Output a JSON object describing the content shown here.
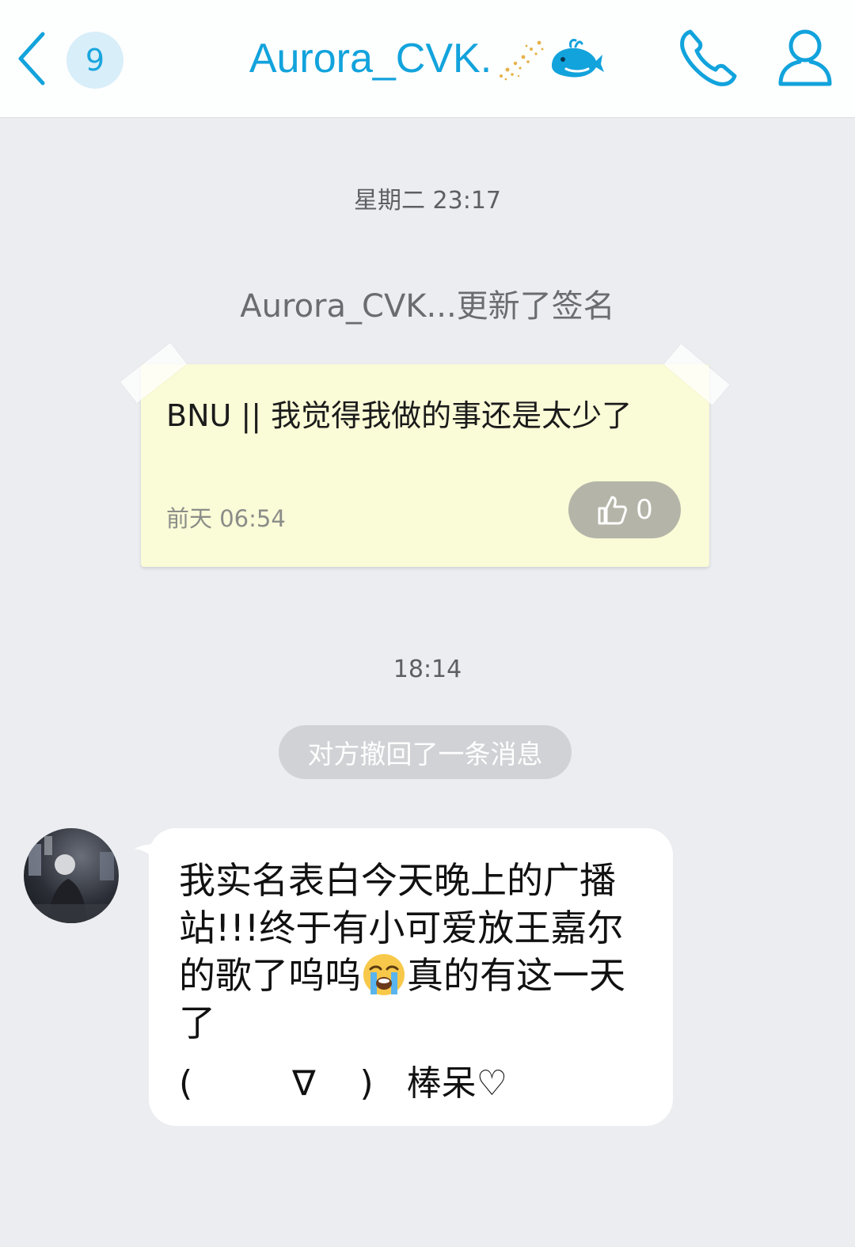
{
  "header": {
    "unread_count": "9",
    "contact_name": "Aurora_CVK.",
    "sparkle_icon": "sparkle-decoration",
    "whale_icon": "blue-whale",
    "accent_color": "#12a3dc"
  },
  "conversation": {
    "timestamp_1": "星期二 23:17",
    "signature_update_text": "Aurora_CVK...更新了签名",
    "signature_card": {
      "text": "BNU || 我觉得我做的事还是太少了",
      "date": "前天 06:54",
      "like_count": "0"
    },
    "timestamp_2": "18:14",
    "recall_notice": "对方撤回了一条消息",
    "message": {
      "line1": "我实名表白今天晚上的广播站!!!终于有小可爱放王嘉尔",
      "line2_pre": "的歌了呜呜",
      "line2_post": "真的有这一天了",
      "emoji": "loudly-crying-face",
      "kaomoji_open": "(",
      "kaomoji_mid": "∇",
      "kaomoji_close": ")",
      "tail_text": "棒呆♡"
    }
  }
}
